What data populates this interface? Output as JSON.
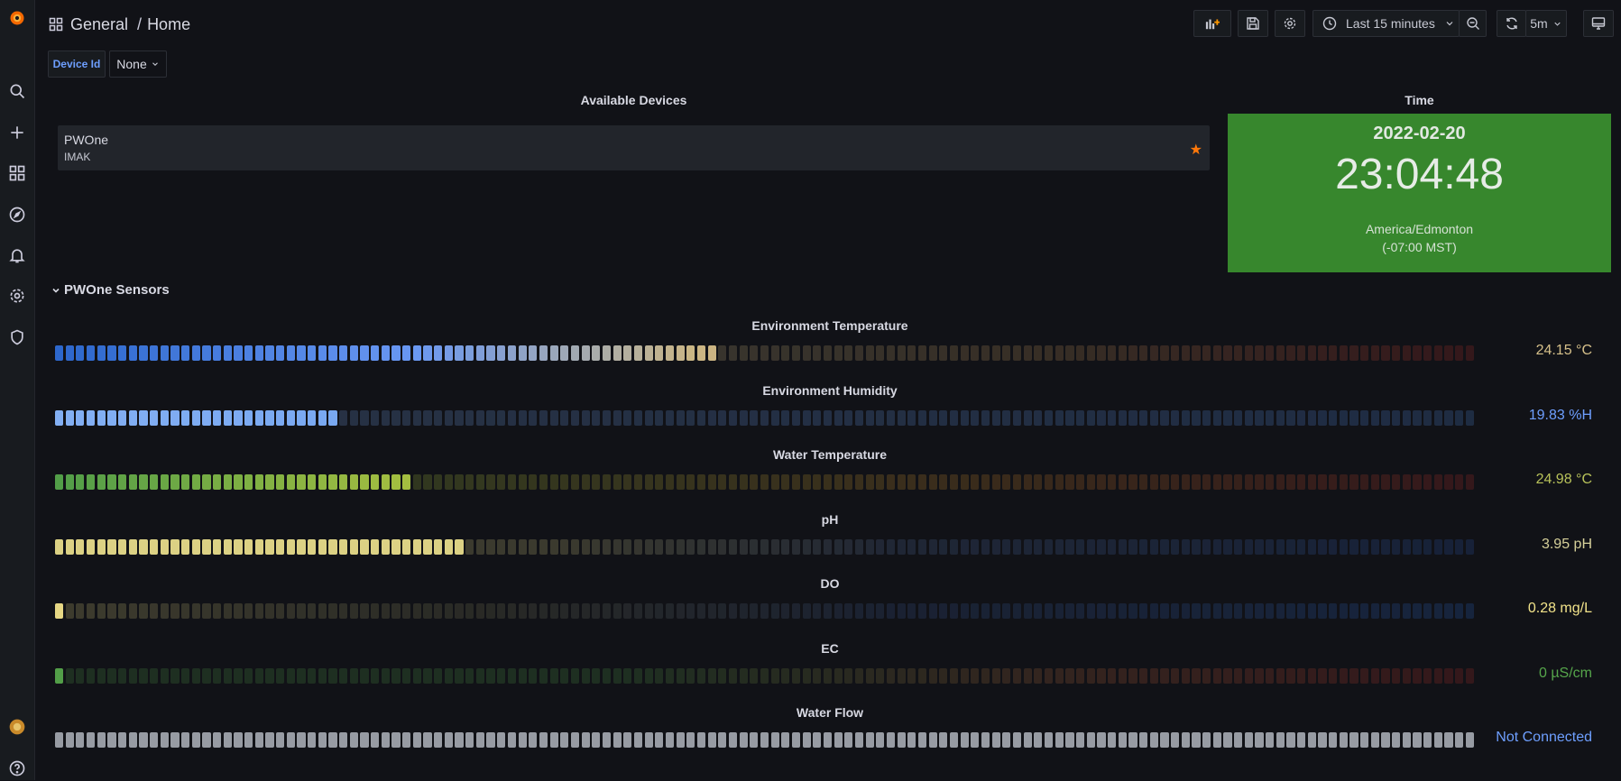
{
  "breadcrumb": {
    "folder": "General",
    "separator": "/",
    "page": "Home"
  },
  "toolbar": {
    "time_range": "Last 15 minutes",
    "refresh_interval": "5m"
  },
  "variables": {
    "label": "Device Id",
    "value": "None"
  },
  "devices_panel": {
    "title": "Available Devices",
    "items": [
      {
        "name": "PWOne",
        "sub": "IMAK",
        "starred": true
      }
    ]
  },
  "clock_panel": {
    "title": "Time",
    "date": "2022-02-20",
    "time": "23:04:48",
    "timezone": "America/Edmonton",
    "offset": "(-07:00 MST)",
    "bg_color": "#37872d"
  },
  "sensors_row": {
    "title": "PWOne Sensors"
  },
  "gauges": [
    {
      "title": "Environment Temperature",
      "value": "24.15 °C",
      "fill_fraction": 0.466,
      "value_color": "#d6c08a",
      "scheme": "temp"
    },
    {
      "title": "Environment Humidity",
      "value": "19.83 %H",
      "fill_fraction": 0.2,
      "value_color": "#6e9fff",
      "scheme": "blue"
    },
    {
      "title": "Water Temperature",
      "value": "24.98 °C",
      "fill_fraction": 0.25,
      "value_color": "#b8c25a",
      "scheme": "greenred"
    },
    {
      "title": "pH",
      "value": "3.95 pH",
      "fill_fraction": 0.287,
      "value_color": "#d6d09a",
      "scheme": "ph"
    },
    {
      "title": "DO",
      "value": "0.28 mg/L",
      "fill_fraction": 0.007,
      "value_color": "#f2e38a",
      "scheme": "do"
    },
    {
      "title": "EC",
      "value": "0 µS/cm",
      "fill_fraction": 0.007,
      "value_color": "#56a64b",
      "scheme": "ec"
    },
    {
      "title": "Water Flow",
      "value": "Not Connected",
      "fill_fraction": 1.0,
      "value_color": "#6e9fff",
      "scheme": "gray"
    }
  ]
}
